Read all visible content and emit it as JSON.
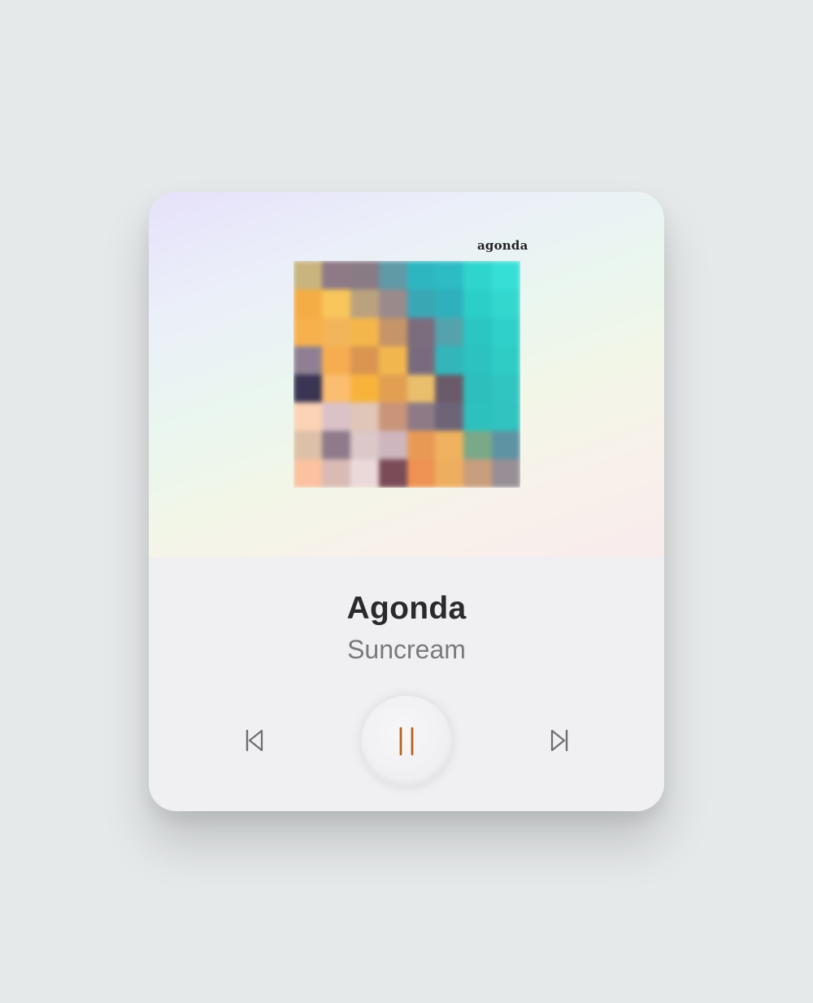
{
  "player": {
    "brand_label": "agonda",
    "track_title": "Agonda",
    "artist_name": "Suncream",
    "icons": {
      "previous": "skip-previous-icon",
      "pause": "pause-icon",
      "next": "skip-next-icon"
    },
    "accent_color": "#b5651d",
    "icon_color": "#6e6e72",
    "album_cover_colors": [
      [
        "#c9b47e",
        "#8d7a86",
        "#887b84",
        "#5f9aa6",
        "#2eb6c0",
        "#2dbcc4",
        "#2fd5cc",
        "#36dfd6"
      ],
      [
        "#f4ad45",
        "#f8c65a",
        "#bba27e",
        "#9a8a8c",
        "#3aa7b5",
        "#2fb0bc",
        "#2ccfc8",
        "#33d7ce"
      ],
      [
        "#f6b04c",
        "#f3b55a",
        "#f4b64b",
        "#c59468",
        "#7b6c7e",
        "#54a3ac",
        "#2bc5c2",
        "#2fd0c9"
      ],
      [
        "#8e8092",
        "#f6ad4f",
        "#da9651",
        "#f2b64f",
        "#7a6a7d",
        "#33b6ba",
        "#2bc2bf",
        "#2fccc5"
      ],
      [
        "#3a3552",
        "#fbbd70",
        "#f7b33b",
        "#e29f52",
        "#e9bf6c",
        "#6a5a6a",
        "#2cbfbc",
        "#30c5c1"
      ],
      [
        "#fbd3b5",
        "#dbc2c8",
        "#e0c6b6",
        "#c99479",
        "#8e7a86",
        "#6e6478",
        "#2cc1bd",
        "#30c3bf"
      ],
      [
        "#ddc0a8",
        "#8e7a8a",
        "#dcc7c9",
        "#cdb6bd",
        "#e89a55",
        "#efb25f",
        "#7aa988",
        "#5e93a4"
      ],
      [
        "#fbc1a0",
        "#d9bbb4",
        "#ebd9da",
        "#7a4c57",
        "#ee9353",
        "#eeae5f",
        "#c89e7d",
        "#988f96"
      ]
    ]
  }
}
